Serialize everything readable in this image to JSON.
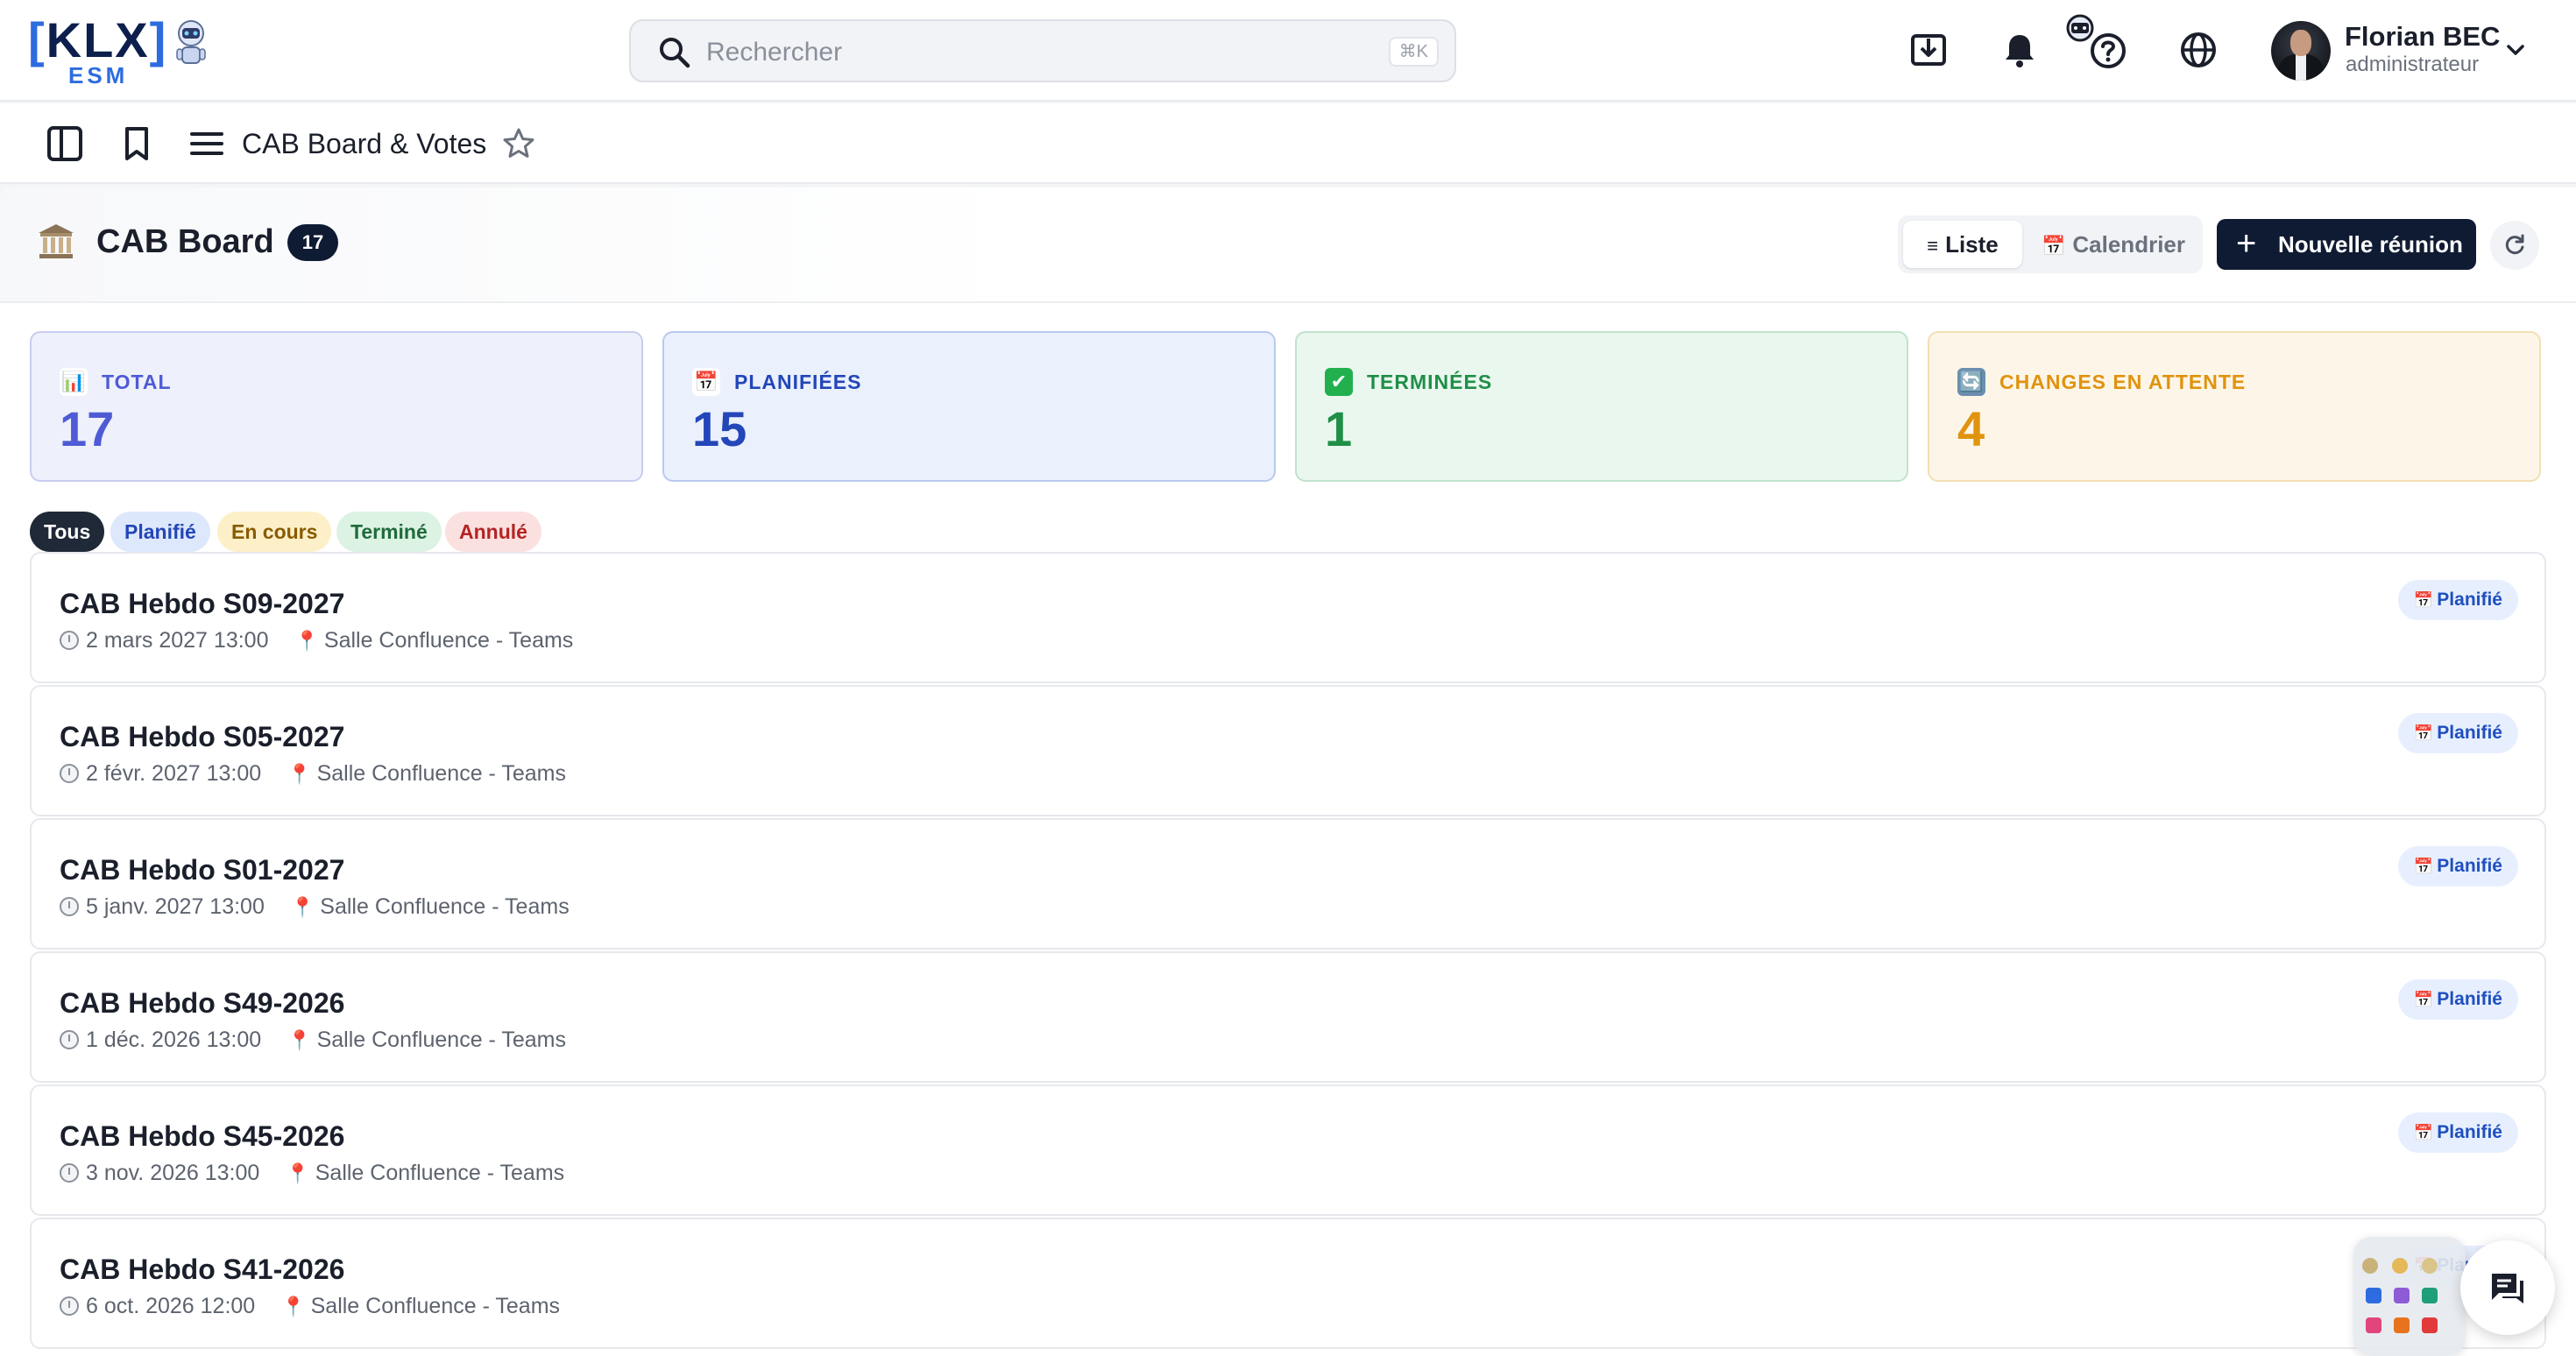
{
  "header": {
    "logo": {
      "text": "KLX",
      "subtext": "ESM",
      "alt": "KLX ESM"
    },
    "search": {
      "placeholder": "Rechercher",
      "shortcut": "⌘K"
    },
    "user": {
      "name": "Florian BEC",
      "role": "administrateur"
    },
    "icons": [
      "download-icon",
      "bell-icon",
      "robot-help-icon",
      "globe-icon"
    ]
  },
  "subbar": {
    "title": "CAB Board & Votes"
  },
  "page": {
    "title": "CAB Board",
    "count": "17",
    "view_toggle": {
      "list_label": "Liste",
      "calendar_label": "Calendrier",
      "selected": "Liste"
    },
    "new_button": "Nouvelle réunion"
  },
  "stats": [
    {
      "label": "TOTAL",
      "value": "17",
      "color": "#4f5bd5",
      "bg": "#eef0fb",
      "border": "#c9cdef",
      "emoji_bg": "#ffffff"
    },
    {
      "label": "PLANIFIÉES",
      "value": "15",
      "color": "#2346b8",
      "bg": "#eaf0fc",
      "border": "#b9c9ee",
      "emoji_bg": "#ffffff"
    },
    {
      "label": "TERMINÉES",
      "value": "1",
      "color": "#1f8f47",
      "bg": "#eaf7ef",
      "border": "#bfe3cc",
      "emoji_bg": "#22b04f"
    },
    {
      "label": "CHANGES EN ATTENTE",
      "value": "4",
      "color": "#e0930e",
      "bg": "#fdf6e8",
      "border": "#f2dfb4",
      "emoji_bg": "#6c8fb0"
    }
  ],
  "filters": [
    {
      "label": "Tous",
      "active": true,
      "bg": "#1f2937",
      "fg": "#ffffff"
    },
    {
      "label": "Planifié",
      "active": false,
      "bg": "#dde8fc",
      "fg": "#2346b8"
    },
    {
      "label": "En cours",
      "active": false,
      "bg": "#fdf0c9",
      "fg": "#8a5a00"
    },
    {
      "label": "Terminé",
      "active": false,
      "bg": "#dcf3e3",
      "fg": "#1f6b3a"
    },
    {
      "label": "Annulé",
      "active": false,
      "bg": "#fbe0e0",
      "fg": "#b42323"
    }
  ],
  "meetings": [
    {
      "title": "CAB Hebdo S09-2027",
      "date": "2 mars 2027 13:00",
      "location": "Salle Confluence - Teams",
      "status": "Planifié"
    },
    {
      "title": "CAB Hebdo S05-2027",
      "date": "2 févr. 2027 13:00",
      "location": "Salle Confluence - Teams",
      "status": "Planifié"
    },
    {
      "title": "CAB Hebdo S01-2027",
      "date": "5 janv. 2027 13:00",
      "location": "Salle Confluence - Teams",
      "status": "Planifié"
    },
    {
      "title": "CAB Hebdo S49-2026",
      "date": "1 déc. 2026 13:00",
      "location": "Salle Confluence - Teams",
      "status": "Planifié"
    },
    {
      "title": "CAB Hebdo S45-2026",
      "date": "3 nov. 2026 13:00",
      "location": "Salle Confluence - Teams",
      "status": "Planifié"
    },
    {
      "title": "CAB Hebdo S41-2026",
      "date": "6 oct. 2026 12:00",
      "location": "Salle Confluence - Teams",
      "status": "Planifié"
    }
  ],
  "colors": {
    "primary_dark": "#0f1b33",
    "accent_blue": "#2d6cdf",
    "badge_bg": "#e7efff",
    "badge_fg": "#1f4fbf"
  }
}
